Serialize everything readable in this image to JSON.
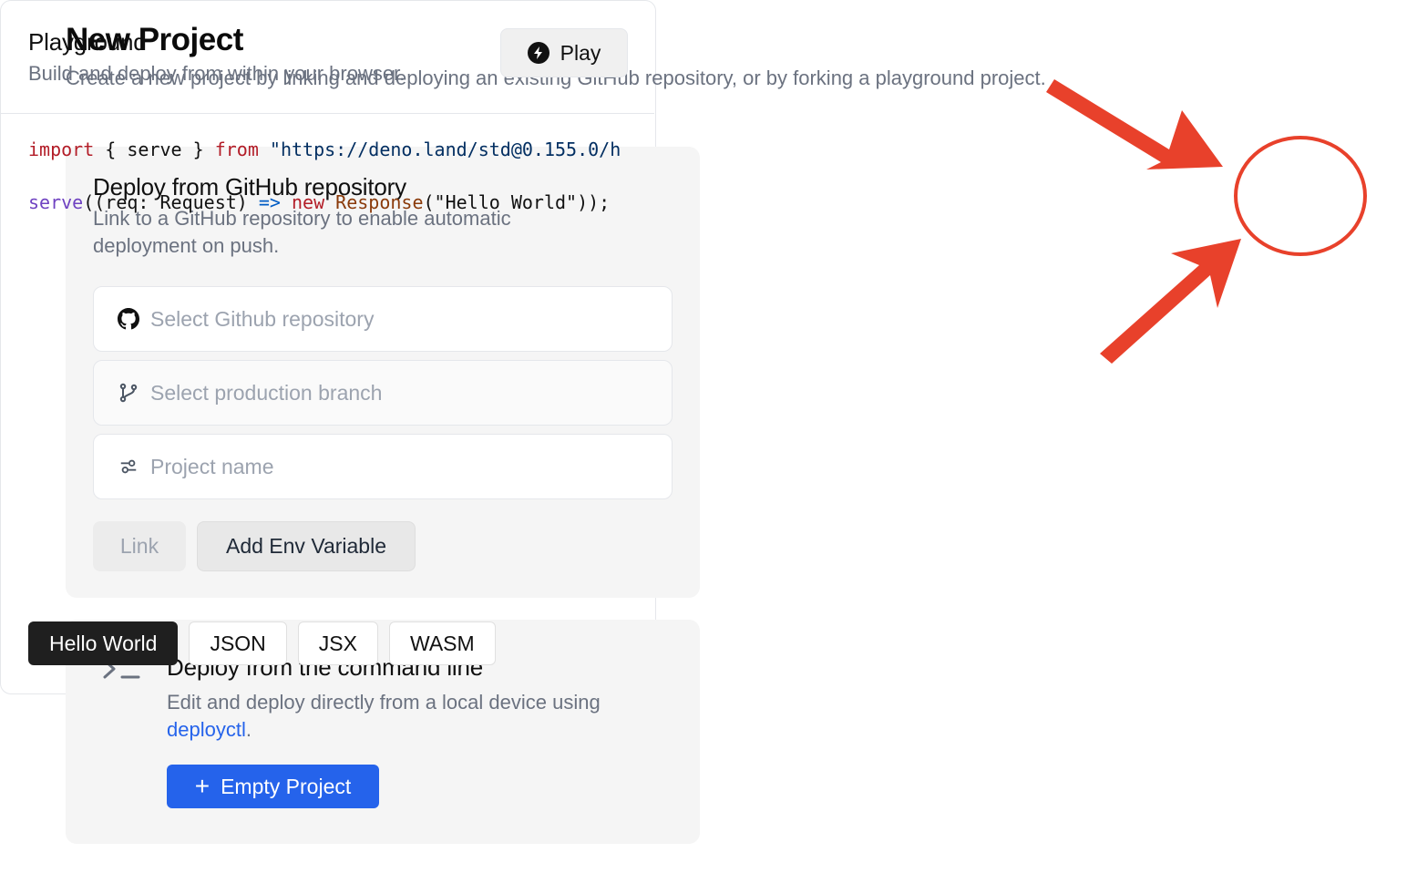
{
  "header": {
    "title": "New Project",
    "subtitle": "Create a new project by linking and deploying an existing GitHub repository, or by forking a playground project."
  },
  "github_card": {
    "title": "Deploy from GitHub repository",
    "description": "Link to a GitHub repository to enable automatic deployment on push.",
    "repo_placeholder": "Select Github repository",
    "branch_placeholder": "Select production branch",
    "name_placeholder": "Project name",
    "link_label": "Link",
    "env_label": "Add Env Variable"
  },
  "cli_card": {
    "title": "Deploy from the command line",
    "description": "Edit and deploy directly from a local device using",
    "link_text": "deployctl",
    "link_suffix": ".",
    "empty_project_label": "Empty Project"
  },
  "playground": {
    "title": "Playground",
    "description": "Build and deploy from within your browser.",
    "play_label": "Play",
    "code": {
      "l1_import": "import",
      "l1_braces": " { serve } ",
      "l1_from": "from",
      "l1_url": " \"https://deno.land/std@0.155.0/h",
      "l2_serve": "serve",
      "l2_args": "((req: Request) ",
      "l2_arrow": "=>",
      "l2_new": " new",
      "l2_response": " Response",
      "l2_msg": "(\"Hello World\"));"
    },
    "tabs": [
      "Hello World",
      "JSON",
      "JSX",
      "WASM"
    ],
    "active_tab": "Hello World"
  },
  "colors": {
    "primary": "#2563eb",
    "annotation": "#e8412b",
    "active_tab": "#1f1f1f"
  }
}
